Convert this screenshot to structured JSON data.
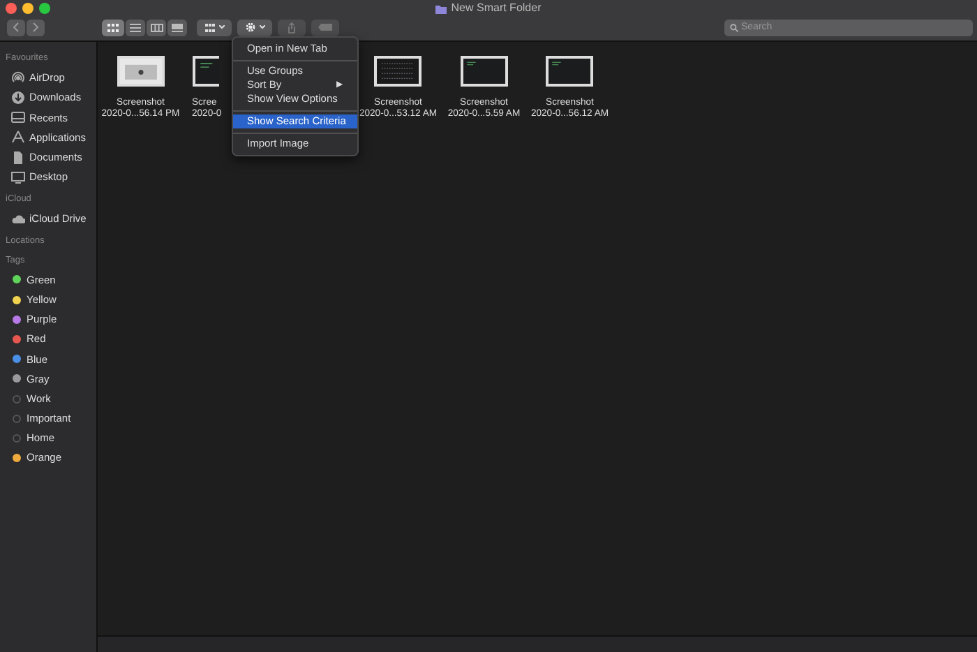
{
  "window": {
    "title": "New Smart Folder"
  },
  "search": {
    "placeholder": "Search"
  },
  "sidebar": [
    {
      "heading": "Favourites",
      "items": [
        {
          "label": "AirDrop",
          "kind": "airdrop"
        },
        {
          "label": "Downloads",
          "kind": "download"
        },
        {
          "label": "Recents",
          "kind": "recents"
        },
        {
          "label": "Applications",
          "kind": "apps"
        },
        {
          "label": "Documents",
          "kind": "doc"
        },
        {
          "label": "Desktop",
          "kind": "desktop"
        }
      ]
    },
    {
      "heading": "iCloud",
      "items": [
        {
          "label": "iCloud Drive",
          "kind": "cloud"
        }
      ]
    },
    {
      "heading": "Locations"
    },
    {
      "heading": "Tags",
      "items": [
        {
          "label": "Green",
          "kind": "tag",
          "color": "#5fd35a"
        },
        {
          "label": "Yellow",
          "kind": "tag",
          "color": "#f2d34f"
        },
        {
          "label": "Purple",
          "kind": "tag",
          "color": "#b679e6"
        },
        {
          "label": "Red",
          "kind": "tag",
          "color": "#e5574f"
        },
        {
          "label": "Blue",
          "kind": "tag",
          "color": "#4a90e8"
        },
        {
          "label": "Gray",
          "kind": "tag",
          "color": "#9a9a9e"
        },
        {
          "label": "Work",
          "kind": "tag"
        },
        {
          "label": "Important",
          "kind": "tag"
        },
        {
          "label": "Home",
          "kind": "tag"
        },
        {
          "label": "Orange",
          "kind": "tag",
          "color": "#f0a93c"
        }
      ]
    }
  ],
  "files": [
    {
      "name": "Screenshot",
      "date": "2020-0...56.14 PM",
      "kind": "light",
      "cut": false
    },
    {
      "name": "Scree",
      "date": "2020-0",
      "kind": "dark",
      "cut": true
    },
    {
      "name": "Screenshot",
      "date": "2020-0...53.12 AM",
      "kind": "grid",
      "cut": false
    },
    {
      "name": "Screenshot",
      "date": "2020-0...5.59 AM",
      "kind": "dark",
      "cut": false
    },
    {
      "name": "Screenshot",
      "date": "2020-0...56.12 AM",
      "kind": "dark",
      "cut": false
    }
  ],
  "menu": [
    {
      "kind": "item",
      "label": "Open in New Tab",
      "selected": false
    },
    {
      "kind": "sep"
    },
    {
      "kind": "item",
      "label": "Use Groups",
      "selected": false
    },
    {
      "kind": "item",
      "label": "Sort By",
      "selected": false,
      "submenu": "▶"
    },
    {
      "kind": "item",
      "label": "Show View Options",
      "selected": false
    },
    {
      "kind": "sep"
    },
    {
      "kind": "item",
      "label": "Show Search Criteria",
      "selected": true
    },
    {
      "kind": "sep"
    },
    {
      "kind": "item",
      "label": "Import Image",
      "selected": false
    }
  ]
}
